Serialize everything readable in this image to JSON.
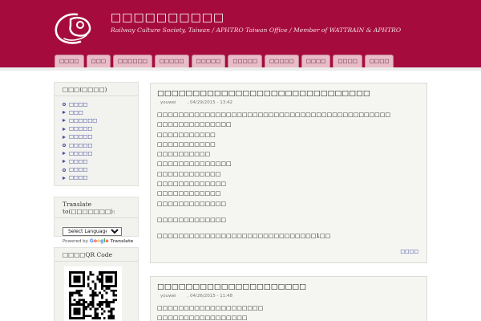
{
  "colors": {
    "header": "#a50c3d",
    "nav_tab": "#e8bcc8",
    "link": "#1f2e8a",
    "block_bg": "#f2f2ef"
  },
  "header": {
    "logo_icon": "train-logo-icon",
    "site_name": "□□□□□□□□□□",
    "slogan": "Railway Culture Society, Taiwan / APHTRO Taiwan Office / Member of WATTRAIN & APHTRO"
  },
  "nav": {
    "tabs": [
      {
        "label": "□□□□"
      },
      {
        "label": "□□□"
      },
      {
        "label": "□□□□□□"
      },
      {
        "label": "□□□□□"
      },
      {
        "label": "□□□□□"
      },
      {
        "label": "□□□□□"
      },
      {
        "label": "□□□□□"
      },
      {
        "label": "□□□□"
      },
      {
        "label": "□□□□"
      },
      {
        "label": "□□□□"
      }
    ]
  },
  "sidebar": {
    "menu_title": "□□□(□□□□)",
    "menu_items": [
      {
        "label": "□□□□",
        "bullet": "circle"
      },
      {
        "label": "□□□",
        "bullet": "triangle"
      },
      {
        "label": "□□□□□□",
        "bullet": "triangle"
      },
      {
        "label": "□□□□□",
        "bullet": "triangle"
      },
      {
        "label": "□□□□□",
        "bullet": "triangle"
      },
      {
        "label": "□□□□□",
        "bullet": "circle"
      },
      {
        "label": "□□□□□",
        "bullet": "triangle"
      },
      {
        "label": "□□□□",
        "bullet": "triangle"
      },
      {
        "label": "□□□□",
        "bullet": "circle"
      },
      {
        "label": "□□□□",
        "bullet": "triangle"
      }
    ],
    "translate_title": "Translate to(□□□□□□□):",
    "select_value": "Select Language",
    "powered_by": "Powered by",
    "translate_word": "Translate",
    "qr_title": "□□□□QR Code",
    "qr_icon": "qr-code-icon"
  },
  "posts": [
    {
      "title": "□□□□□□□□□□□□□□□□□□□□□□□□□□□□□□",
      "author": "youwei",
      "date": ", 04/29/2015 - 13:42",
      "lines": [
        "□□□□□□□□□□□□□□□□□□□□□□□□□□□□□□□□□□□□□□□□□□□□",
        "□□□□□□□□□□□□□□",
        "□□□□□□□□□□□",
        "□□□□□□□□□□□",
        "□□□□□□□□□□",
        "□□□□□□□□□□□□□□",
        "□□□□□□□□□□□□",
        "□□□□□□□□□□□□□",
        "□□□□□□□□□□□□",
        "□□□□□□□□□□□□□"
      ],
      "closing_lines": [
        "□□□□□□□□□□□□□",
        "□□□□□□□□□□□□□□□□□□□□□□□□□□□□□□1□□"
      ],
      "read_more": "□□□□"
    },
    {
      "title": "□□□□□□□□□□□□□□□□□□□□□",
      "author": "youwei",
      "date": ", 04/26/2015 - 11:48",
      "lines": [
        "□□□□□□□□□□□□□□□□□□□□",
        "□□□□□□□□□□□□□□□□□"
      ]
    }
  ]
}
